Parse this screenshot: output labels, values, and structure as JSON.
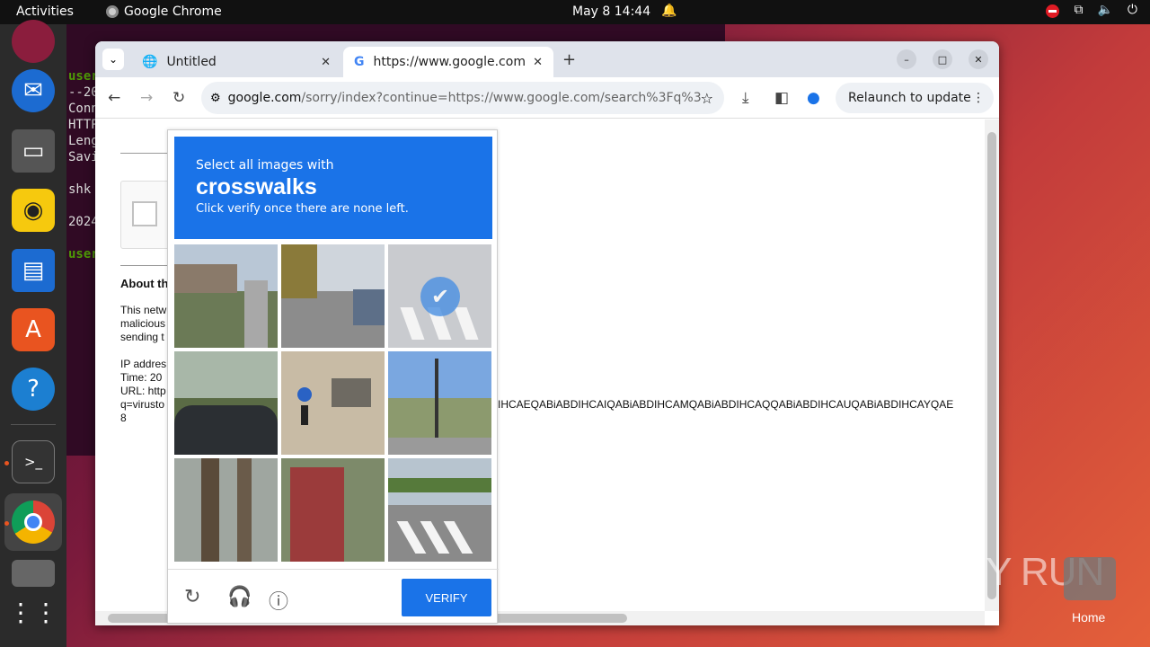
{
  "topbar": {
    "activities": "Activities",
    "app": "Google Chrome",
    "clock": "May 8  14:44"
  },
  "terminal": {
    "lines": [
      "user",
      "--20",
      "Conn",
      "HTTP",
      "Leng",
      "Savi",
      "shk",
      "2024",
      "user"
    ]
  },
  "browser": {
    "tabs": [
      {
        "title": "Untitled",
        "icon": "globe-icon"
      },
      {
        "title": "https://www.google.com",
        "icon": "google-icon"
      }
    ],
    "url_host": "google.com",
    "url_path": "/sorry/index?continue=https://www.google.com/search%3Fq%3D...",
    "relaunch": "Relaunch to update"
  },
  "page": {
    "about": "About th",
    "para": [
      "This netw",
      "malicious",
      "sending t"
    ],
    "info": [
      "IP addres",
      "Time: 20",
      "URL: http",
      "q=virusto",
      "8"
    ],
    "long_tail": "IHCAEQABiABDIHCAIQABiABDIHCAMQABiABDIHCAQQABiABDIHCAUQABiABDIHCAYQAE"
  },
  "captcha": {
    "line1": "Select all images with",
    "keyword": "crosswalks",
    "line3": "Click verify once there are none left.",
    "verify": "VERIFY",
    "selected_tile": 3
  },
  "desktop": {
    "watermark": "ANY RUN",
    "home": "Home"
  }
}
